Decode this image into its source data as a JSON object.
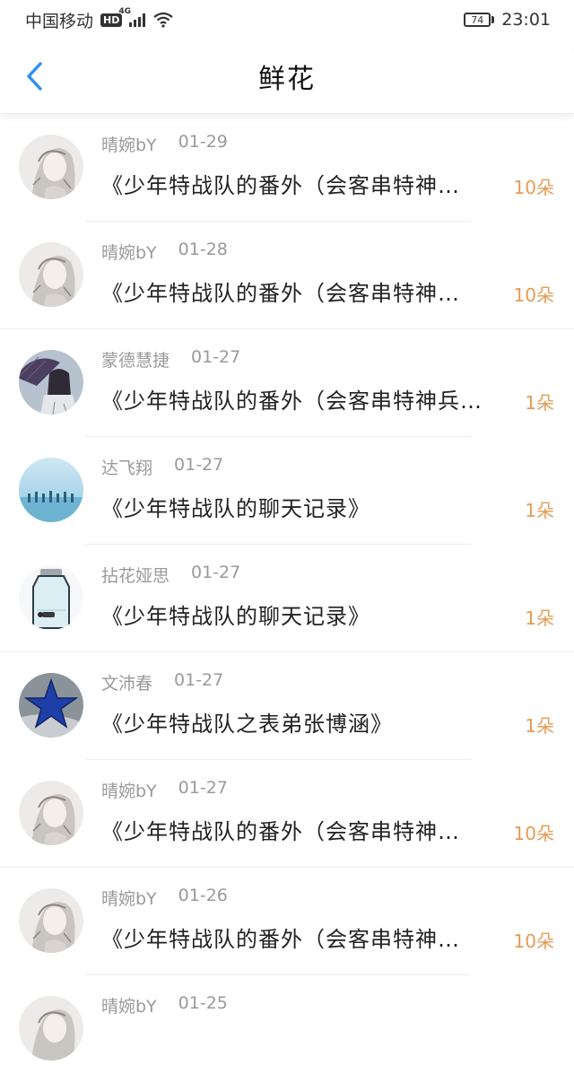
{
  "status_bar": {
    "carrier": "中国移动",
    "hd_badge": "HD",
    "network": "4G",
    "battery": "74",
    "time": "23:01"
  },
  "nav": {
    "title": "鲜花",
    "back_icon": "chevron-left-icon",
    "accent_color": "#2d8ff0"
  },
  "items": [
    {
      "user": "晴婉bY",
      "date": "01-29",
      "title": "《少年特战队的番外（会客串特神…",
      "count": "10朵",
      "avatar": "girl-sketch"
    },
    {
      "user": "晴婉bY",
      "date": "01-28",
      "title": "《少年特战队的番外（会客串特神…",
      "count": "10朵",
      "avatar": "girl-sketch"
    },
    {
      "user": "蒙德慧捷",
      "date": "01-27",
      "title": "《少年特战队的番外（会客串特神兵…",
      "count": "1朵",
      "avatar": "umbrella-figure"
    },
    {
      "user": "达飞翔",
      "date": "01-27",
      "title": "《少年特战队的聊天记录》",
      "count": "1朵",
      "avatar": "sky-silhouettes"
    },
    {
      "user": "拈花娅思",
      "date": "01-27",
      "title": "《少年特战队的聊天记录》",
      "count": "1朵",
      "avatar": "glass-jar"
    },
    {
      "user": "文沛春",
      "date": "01-27",
      "title": "《少年特战队之表弟张博涵》",
      "count": "1朵",
      "avatar": "blue-star"
    },
    {
      "user": "晴婉bY",
      "date": "01-27",
      "title": "《少年特战队的番外（会客串特神…",
      "count": "10朵",
      "avatar": "girl-sketch"
    },
    {
      "user": "晴婉bY",
      "date": "01-26",
      "title": "《少年特战队的番外（会客串特神…",
      "count": "10朵",
      "avatar": "girl-sketch"
    },
    {
      "user": "晴婉bY",
      "date": "01-25",
      "title": "",
      "count": "",
      "avatar": "girl-sketch"
    }
  ],
  "colors": {
    "count": "#e69b54",
    "meta": "#9a9a9a",
    "divider": "#ededed"
  }
}
